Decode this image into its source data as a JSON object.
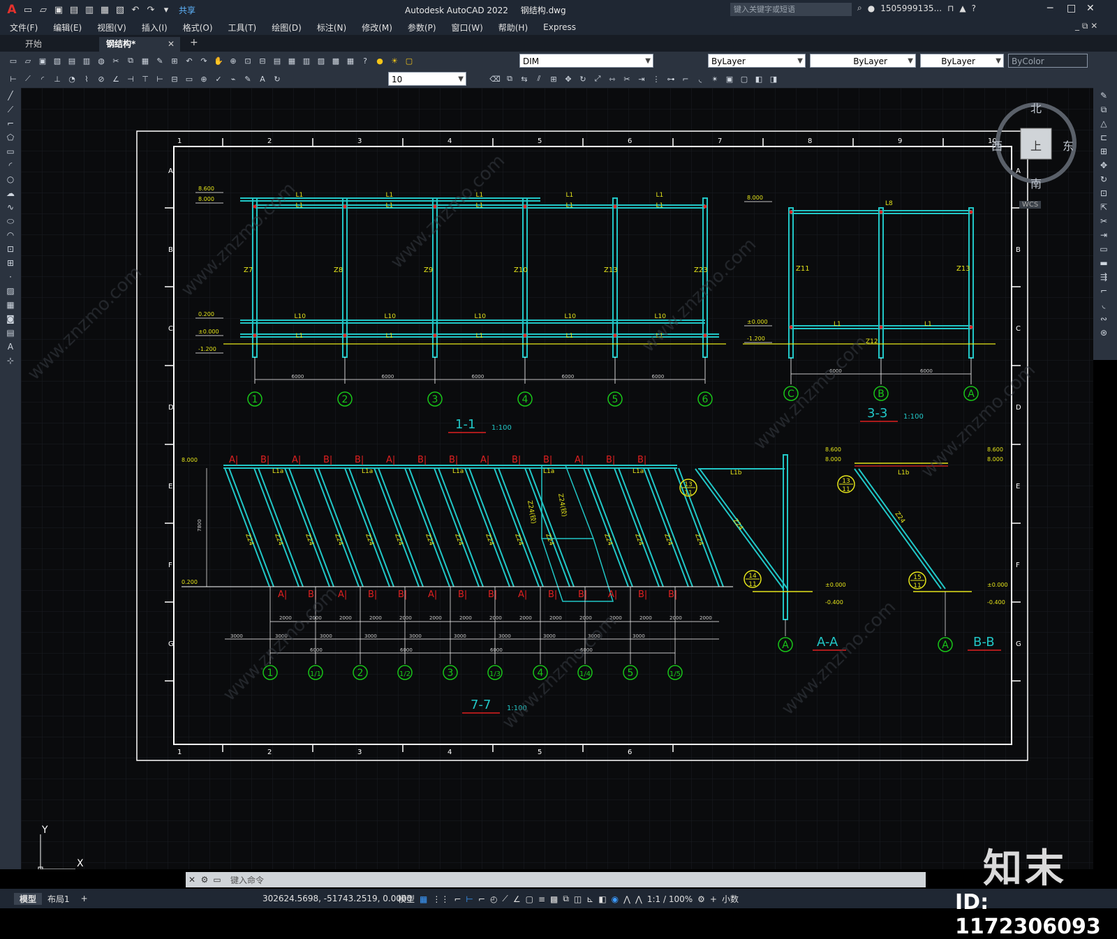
{
  "app": {
    "logo": "A",
    "title": "Autodesk AutoCAD 2022",
    "file": "钢结构.dwg",
    "share": "共享",
    "search_placeholder": "键入关键字或短语",
    "user": "1505999135...",
    "help": "?"
  },
  "menu": [
    "文件(F)",
    "编辑(E)",
    "视图(V)",
    "插入(I)",
    "格式(O)",
    "工具(T)",
    "绘图(D)",
    "标注(N)",
    "修改(M)",
    "参数(P)",
    "窗口(W)",
    "帮助(H)",
    "Express"
  ],
  "tabs": {
    "start": "开始",
    "active": "钢结构*"
  },
  "layers": {
    "current_layer": "DIM",
    "color": "ByLayer",
    "linetype": "ByLayer",
    "lineweight": "ByLayer",
    "plotstyle": "ByColor",
    "dim_scale": "10"
  },
  "viewcube": {
    "north": "北",
    "south": "南",
    "east": "东",
    "west": "西",
    "face": "上",
    "wcs": "WCS"
  },
  "drawing": {
    "border_cols_top": [
      "1",
      "2",
      "3",
      "4",
      "5",
      "6",
      "7",
      "8",
      "9",
      "10"
    ],
    "border_cols_bottom": [
      "1",
      "2",
      "3",
      "4",
      "5",
      "6"
    ],
    "border_rows": [
      "A",
      "B",
      "C",
      "D",
      "E",
      "F",
      "G"
    ],
    "section_1_1": {
      "title": "1-1",
      "scale": "1:100",
      "axes": [
        "1",
        "2",
        "3",
        "4",
        "5",
        "6"
      ],
      "columns": [
        "Z7",
        "Z8",
        "Z9",
        "Z10",
        "Z13",
        "Z23"
      ],
      "beam_top": "L1",
      "beam_mid": "L10",
      "spans": [
        "6000",
        "6000",
        "6000",
        "6000",
        "6000"
      ],
      "levels": [
        "8.600",
        "8.000",
        "0.200",
        "±0.000",
        "-1.200"
      ]
    },
    "section_3_3": {
      "title": "3-3",
      "scale": "1:100",
      "axes": [
        "C",
        "B",
        "A"
      ],
      "columns": [
        "Z11",
        "Z13"
      ],
      "beam_top": "L8",
      "beam_low": "L1",
      "base": "Z12",
      "spans": [
        "6000",
        "6000"
      ],
      "levels": [
        "8.000",
        "±0.000",
        "-1.200"
      ]
    },
    "section_7_7": {
      "title": "7-7",
      "scale": "1:100",
      "axes": [
        "1",
        "1/1",
        "2",
        "1/2",
        "3",
        "1/3",
        "4",
        "1/4",
        "5",
        "1/5"
      ],
      "brace": "Z24",
      "brace_special": "Z24(铰)",
      "beam": "L1a",
      "levels": [
        "8.000",
        "0.200"
      ],
      "height": "7800",
      "dim_a": "2000",
      "dim_b": "3000",
      "dim_c": "6000"
    },
    "section_a_a": {
      "title": "A-A",
      "axis": "A",
      "beam": "L1b",
      "brace": "Z24",
      "callouts": [
        "13/11",
        "14/11"
      ],
      "levels": [
        "8.600",
        "8.000",
        "±0.000",
        "-0.400"
      ]
    },
    "section_b_b": {
      "title": "B-B",
      "axis": "A",
      "beam": "L1b",
      "brace": "Z24",
      "callouts": [
        "13/11",
        "15/11"
      ],
      "levels": [
        "8.600",
        "8.000",
        "±0.000",
        "-0.400"
      ]
    }
  },
  "command": {
    "placeholder": "键入命令"
  },
  "status": {
    "tabs": [
      "模型",
      "布局1"
    ],
    "add": "+",
    "coords": "302624.5698, -51743.2519, 0.0000",
    "mode": "模型",
    "scale": "1:1 / 100%",
    "units": "小数"
  },
  "watermark": {
    "logo": "知末",
    "id": "ID: 1172306093",
    "url": "www.znzmo.com"
  },
  "colors": {
    "cyan": "#21c6c6",
    "yellow": "#e5e51a",
    "red": "#e02020",
    "green": "#19c519",
    "white": "#ffffff",
    "canvas": "#0a0b0d",
    "chrome": "#1f2733"
  }
}
